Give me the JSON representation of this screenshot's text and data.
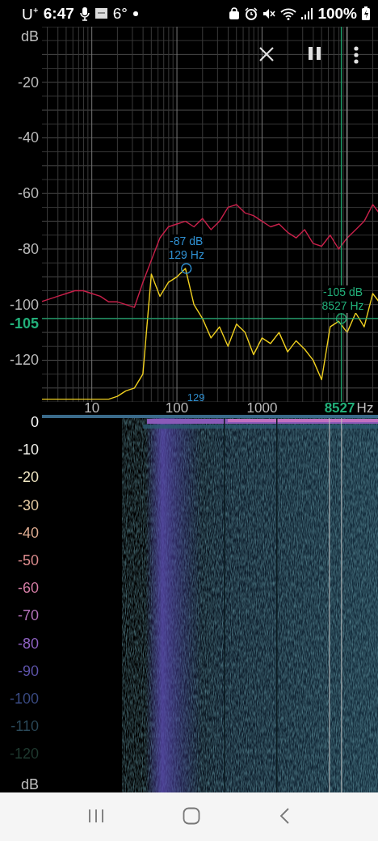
{
  "status_bar": {
    "carrier": "U⁺",
    "time": "6:47",
    "temperature": "6°",
    "battery": "100%"
  },
  "spectrum": {
    "y_unit": "dB",
    "x_unit": "Hz",
    "peak_axis_label": "129",
    "cursor_axis_label": "8527",
    "peak_marker": {
      "level": "-87 dB",
      "frequency": "129 Hz"
    },
    "cursor_marker": {
      "level": "-105 dB",
      "frequency": "8527 Hz"
    },
    "chart_data": {
      "type": "line",
      "grid": true,
      "ref_lines": [
        {
          "axis": "y",
          "value": -105,
          "label": "-105",
          "color": "#1fa870"
        }
      ],
      "ylim": [
        -135,
        0
      ],
      "yticks": [
        {
          "value": -20,
          "label": "-20"
        },
        {
          "value": -40,
          "label": "-40"
        },
        {
          "value": -60,
          "label": "-60"
        },
        {
          "value": -80,
          "label": "-80"
        },
        {
          "value": -100,
          "label": "-100"
        },
        {
          "value": -120,
          "label": "-120"
        }
      ],
      "categories": [
        null,
        null,
        null,
        null,
        null,
        null,
        "10",
        null,
        null,
        null,
        null,
        null,
        null,
        null,
        null,
        null,
        "100",
        null,
        null,
        null,
        null,
        null,
        null,
        null,
        null,
        null,
        "1000",
        null,
        null,
        null,
        null,
        null,
        null,
        null,
        null,
        null,
        null,
        null,
        null,
        null,
        null
      ],
      "series": [
        {
          "color": "#c8204a",
          "values": [
            -99,
            -98,
            -97,
            -96,
            -95,
            -95,
            -96,
            -97,
            -99,
            -99,
            -100,
            -101,
            -92,
            -84,
            -76,
            -72,
            -71,
            -70,
            -72,
            -69,
            -73,
            -70,
            -65,
            -64,
            -67,
            -68,
            -70,
            -72,
            -71,
            -74,
            -76,
            -73,
            -78,
            -79,
            -75,
            -80,
            -76,
            -73,
            -70,
            -64,
            -68
          ]
        },
        {
          "color": "#f0d020",
          "values": [
            -134,
            -134,
            -134,
            -134,
            -134,
            -134,
            -134,
            -134,
            -134,
            -133,
            -131,
            -130,
            -125,
            -89,
            -97,
            -92,
            -90,
            -87,
            -100,
            -105,
            -112,
            -108,
            -115,
            -107,
            -110,
            -118,
            -112,
            -114,
            -110,
            -117,
            -113,
            -116,
            -120,
            -127,
            -108,
            -106,
            -110,
            -103,
            -108,
            -96,
            -100
          ]
        }
      ]
    }
  },
  "spectrogram": {
    "unit": "dB",
    "scale": [
      {
        "label": "0",
        "color": "#ffffff"
      },
      {
        "label": "-10",
        "color": "#f4f4ee"
      },
      {
        "label": "-20",
        "color": "#efe6c2"
      },
      {
        "label": "-30",
        "color": "#e6cba2"
      },
      {
        "label": "-40",
        "color": "#e0ad92"
      },
      {
        "label": "-50",
        "color": "#dd8c8e"
      },
      {
        "label": "-60",
        "color": "#d67ea6"
      },
      {
        "label": "-70",
        "color": "#b774bd"
      },
      {
        "label": "-80",
        "color": "#9063c4"
      },
      {
        "label": "-90",
        "color": "#5f55ad"
      },
      {
        "label": "-100",
        "color": "#3b4c85"
      },
      {
        "label": "-110",
        "color": "#2a4858"
      },
      {
        "label": "-120",
        "color": "#1f3a30"
      }
    ]
  }
}
